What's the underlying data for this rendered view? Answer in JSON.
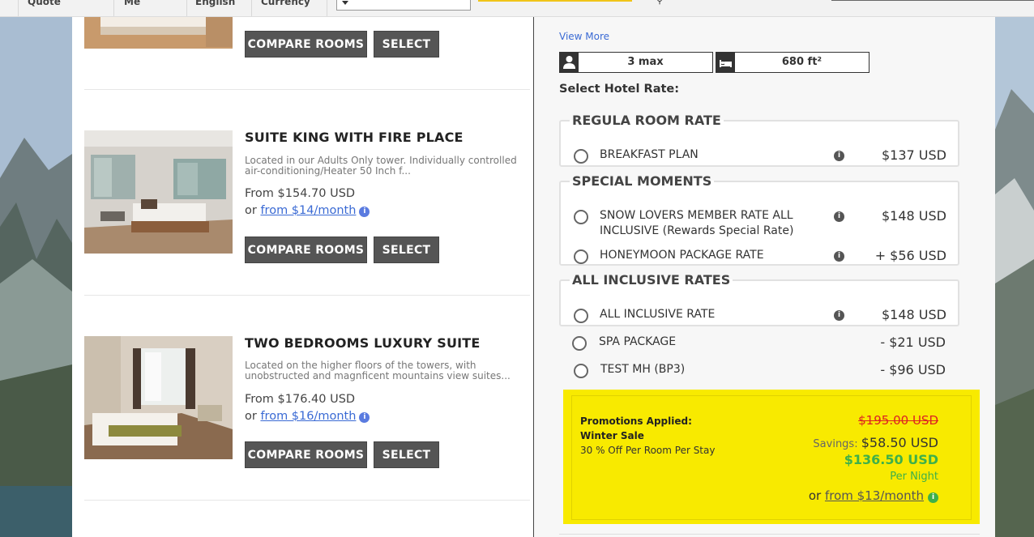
{
  "topbar": {
    "items": [
      "Quote",
      "Me",
      "English",
      "Currency"
    ],
    "select_value": ""
  },
  "rooms": [
    {
      "name": "",
      "buttons": {
        "compare": "COMPARE ROOMS",
        "select": "SELECT"
      }
    },
    {
      "name": "SUITE KING WITH FIRE PLACE",
      "description": "Located in our Adults Only tower.  Individually controlled air-conditioning/Heater 50 Inch f...",
      "price": "From $154.70 USD",
      "monthly_prefix": "or ",
      "monthly_link": "from $14/month",
      "buttons": {
        "compare": "COMPARE ROOMS",
        "select": "SELECT"
      }
    },
    {
      "name": "TWO BEDROOMS LUXURY SUITE",
      "description": "Located on the higher floors of the towers, with unobstructed and magnficent mountains view suites...",
      "price": "From $176.40 USD",
      "monthly_prefix": "or ",
      "monthly_link": "from $16/month",
      "buttons": {
        "compare": "COMPARE ROOMS",
        "select": "SELECT"
      }
    }
  ],
  "details": {
    "view_more": "View More",
    "occupancy": "3 max",
    "size": "680 ft²",
    "select_rate_label": "Select Hotel Rate:"
  },
  "rate_groups": [
    {
      "title": "REGULA ROOM RATE",
      "rates": [
        {
          "label": "BREAKFAST PLAN",
          "price": "$137 USD"
        }
      ]
    },
    {
      "title": "SPECIAL MOMENTS",
      "rates": [
        {
          "label": "SNOW LOVERS MEMBER RATE ALL INCLUSIVE (Rewards Special Rate)",
          "price": "$148 USD"
        },
        {
          "label": "HONEYMOON PACKAGE RATE",
          "price": "+ $56 USD"
        }
      ]
    },
    {
      "title": "ALL INCLUSIVE RATES",
      "rates": [
        {
          "label": "ALL INCLUSIVE RATE",
          "price": "$148 USD"
        }
      ]
    }
  ],
  "loose_rates": [
    {
      "label": "SPA PACKAGE",
      "price": "- $21 USD"
    },
    {
      "label": "TEST MH (BP3)",
      "price": "- $96 USD"
    }
  ],
  "promo": {
    "title": "Promotions Applied:",
    "name": "Winter Sale",
    "description": "30 % Off Per Room Per Stay",
    "original_price": "$195.00 USD",
    "savings_label": "Savings: ",
    "savings_value": "$58.50 USD",
    "new_price": "$136.50 USD",
    "per": "Per Night",
    "monthly_prefix": "or ",
    "monthly_link": "from $13/month"
  },
  "colors": {
    "promo_bg": "#f8ea00",
    "accent_green": "#3db04a",
    "link_blue": "#3a6ad4",
    "button_gray": "#555555"
  }
}
